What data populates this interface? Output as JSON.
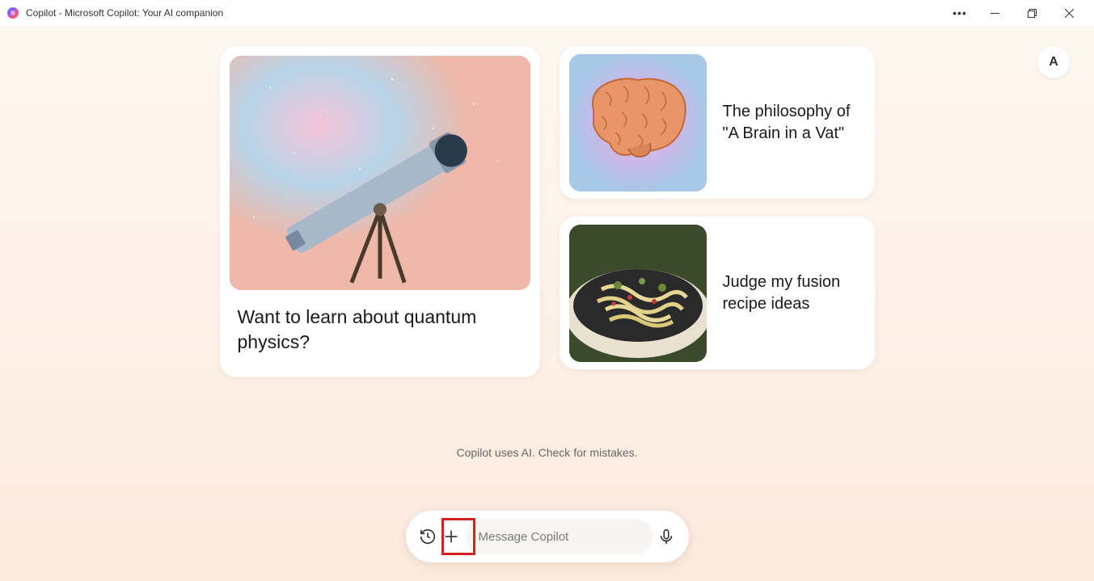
{
  "titlebar": {
    "title": "Copilot - Microsoft Copilot: Your AI companion"
  },
  "avatar": {
    "initial": "A"
  },
  "cards": {
    "large": {
      "text": "Want to learn about quantum physics?"
    },
    "small1": {
      "text": "The philosophy of \"A Brain in a Vat\""
    },
    "small2": {
      "text": "Judge my fusion recipe ideas"
    }
  },
  "disclaimer": "Copilot uses AI. Check for mistakes.",
  "input": {
    "placeholder": "Message Copilot"
  }
}
